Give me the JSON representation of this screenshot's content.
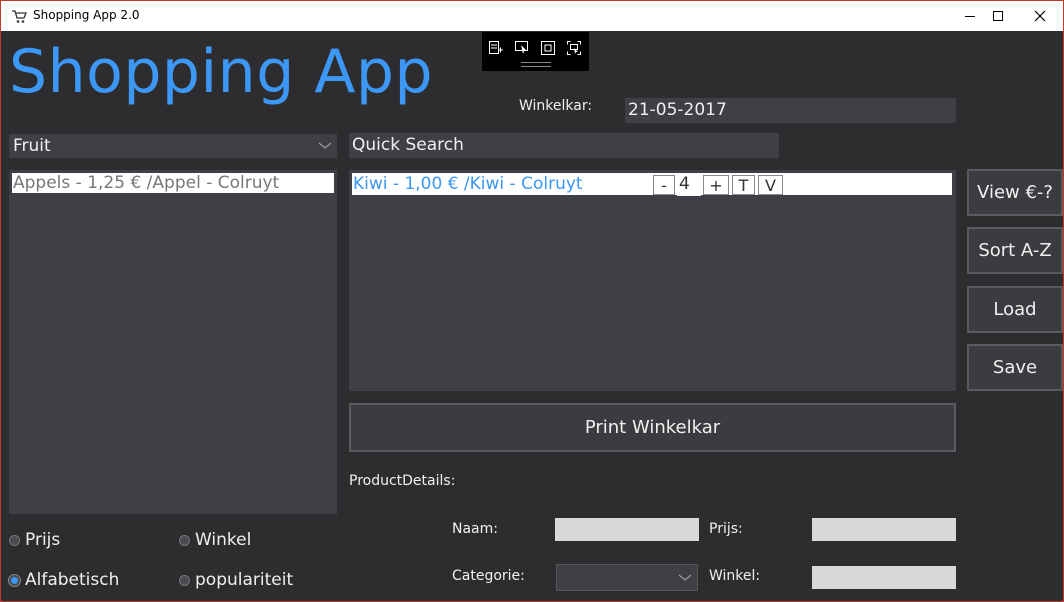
{
  "window": {
    "title": "Shopping App 2.0"
  },
  "app": {
    "heading": "Shopping App"
  },
  "cart": {
    "label": "Winkelkar:",
    "date": "21-05-2017"
  },
  "category": {
    "selected": "Fruit"
  },
  "products": [
    {
      "label": "Appels - 1,25 € /Appel - Colruyt"
    }
  ],
  "search": {
    "value": "Quick Search"
  },
  "cart_items": [
    {
      "label": "Kiwi - 1,00 €  /Kiwi - Colruyt",
      "minus": "-",
      "qty": "4",
      "plus": "+",
      "t": "T",
      "v": "V"
    }
  ],
  "buttons": {
    "view": "View €-?",
    "sort": "Sort A-Z",
    "load": "Load",
    "save": "Save",
    "print": "Print Winkelkar"
  },
  "details": {
    "heading": "ProductDetails:",
    "naam": "Naam:",
    "prijs": "Prijs:",
    "categorie": "Categorie:",
    "winkel": "Winkel:"
  },
  "sort_options": [
    {
      "label": "Prijs",
      "checked": false
    },
    {
      "label": "Winkel",
      "checked": false
    },
    {
      "label": "Alfabetisch",
      "checked": true
    },
    {
      "label": "populariteit",
      "checked": false
    }
  ],
  "colors": {
    "accent": "#3c97f5",
    "background": "#2d2d30",
    "panel": "#3f3f46"
  },
  "icons": {
    "app": "shopping-cart-icon",
    "minimize": "minimize-icon",
    "maximize": "maximize-icon",
    "close": "close-icon"
  }
}
